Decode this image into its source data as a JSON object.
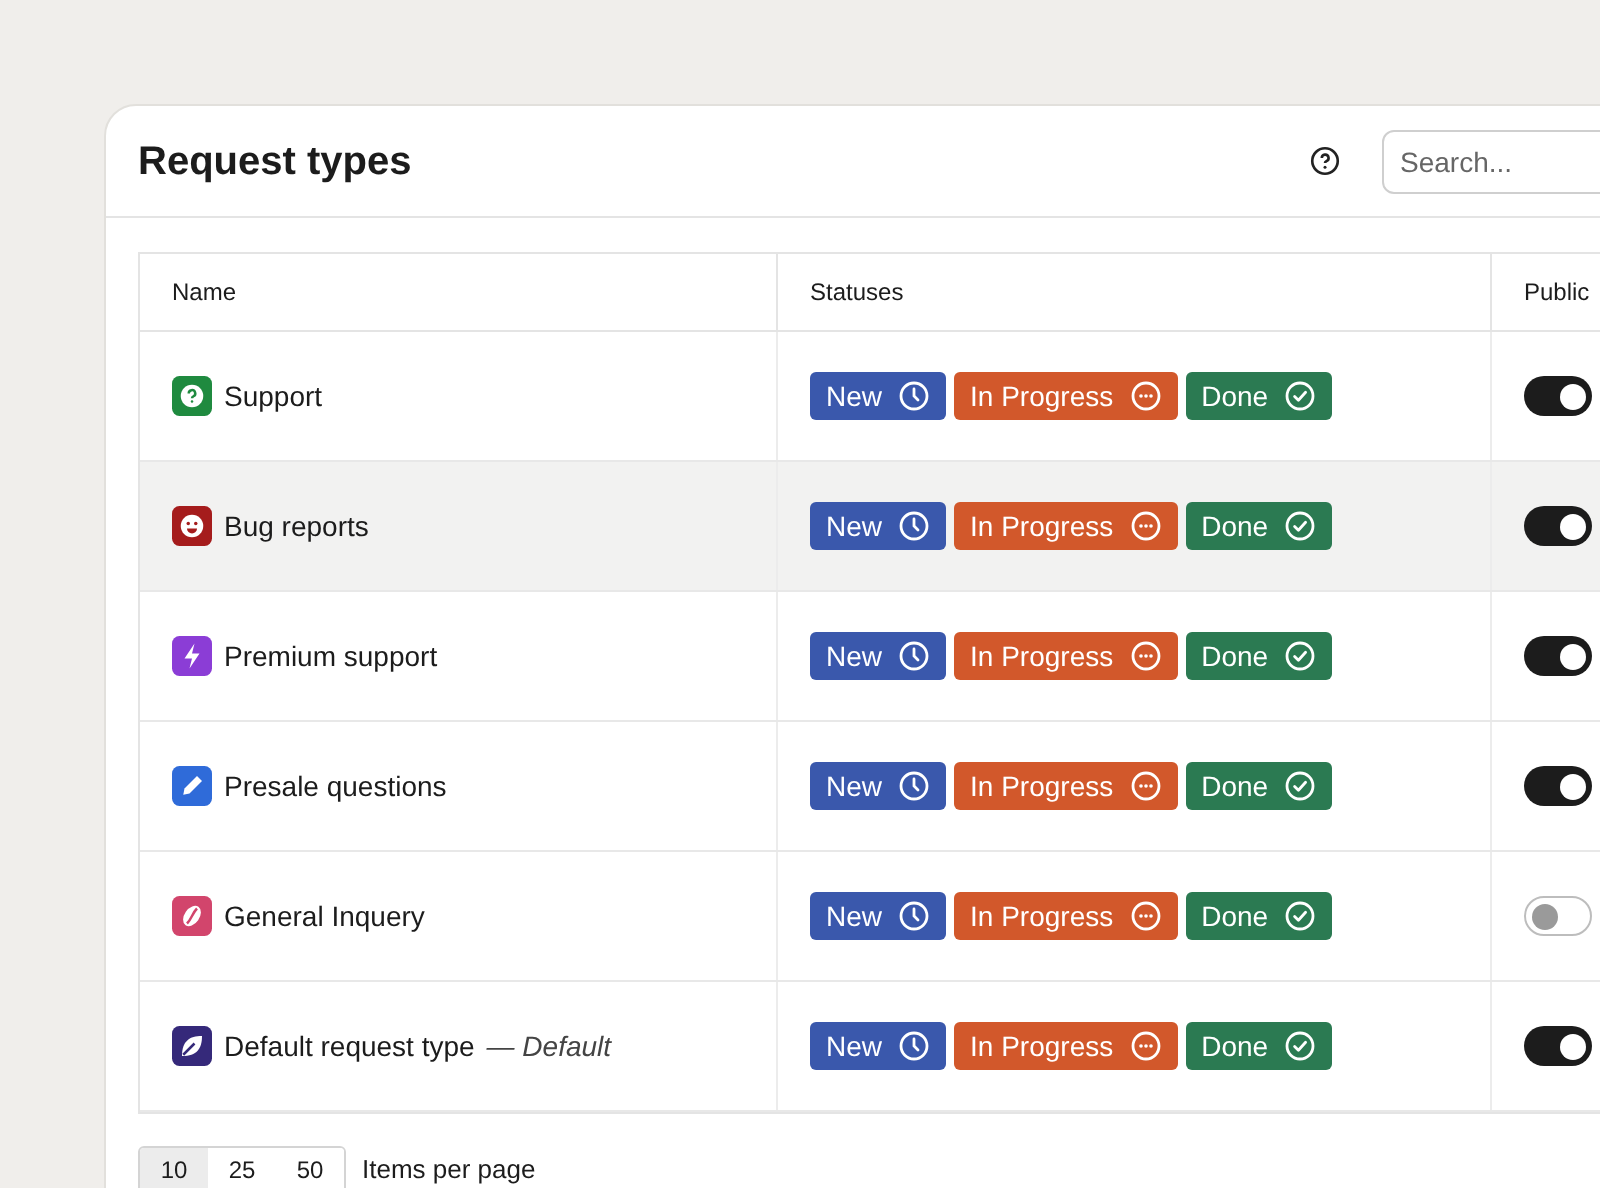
{
  "header": {
    "title": "Request types",
    "search": {
      "placeholder": "Search..."
    }
  },
  "table": {
    "columns": [
      "Name",
      "Statuses",
      "Public"
    ],
    "rows": [
      {
        "name": "Support",
        "kind": "question",
        "color": "#1f8a3f",
        "highlighted": false,
        "public": true,
        "statuses": [
          {
            "kind": "new",
            "label": "New"
          },
          {
            "kind": "in_progress",
            "label": "In Progress"
          },
          {
            "kind": "done",
            "label": "Done"
          }
        ]
      },
      {
        "name": "Bug reports",
        "kind": "smile",
        "color": "#a51c1c",
        "highlighted": true,
        "public": true,
        "statuses": [
          {
            "kind": "new",
            "label": "New"
          },
          {
            "kind": "in_progress",
            "label": "In Progress"
          },
          {
            "kind": "done",
            "label": "Done"
          }
        ]
      },
      {
        "name": "Premium support",
        "kind": "bolt",
        "color": "#8b3dd6",
        "highlighted": false,
        "public": true,
        "statuses": [
          {
            "kind": "new",
            "label": "New"
          },
          {
            "kind": "in_progress",
            "label": "In Progress"
          },
          {
            "kind": "done",
            "label": "Done"
          }
        ]
      },
      {
        "name": "Presale questions",
        "kind": "pencil",
        "color": "#2f6bd9",
        "highlighted": false,
        "public": true,
        "statuses": [
          {
            "kind": "new",
            "label": "New"
          },
          {
            "kind": "in_progress",
            "label": "In Progress"
          },
          {
            "kind": "done",
            "label": "Done"
          }
        ]
      },
      {
        "name": "General Inquery",
        "kind": "bean",
        "color": "#d2456c",
        "highlighted": false,
        "public": false,
        "statuses": [
          {
            "kind": "new",
            "label": "New"
          },
          {
            "kind": "in_progress",
            "label": "In Progress"
          },
          {
            "kind": "done",
            "label": "Done"
          }
        ]
      },
      {
        "name": "Default request type",
        "note": "— Default",
        "kind": "leaf",
        "color": "#35297a",
        "highlighted": false,
        "public": true,
        "statuses": [
          {
            "kind": "new",
            "label": "New"
          },
          {
            "kind": "in_progress",
            "label": "In Progress"
          },
          {
            "kind": "done",
            "label": "Done"
          }
        ]
      }
    ]
  },
  "pagination": {
    "sizes": [
      {
        "label": "10",
        "selected": true
      },
      {
        "label": "25",
        "selected": false
      },
      {
        "label": "50",
        "selected": false
      }
    ],
    "label": "Items per page"
  }
}
